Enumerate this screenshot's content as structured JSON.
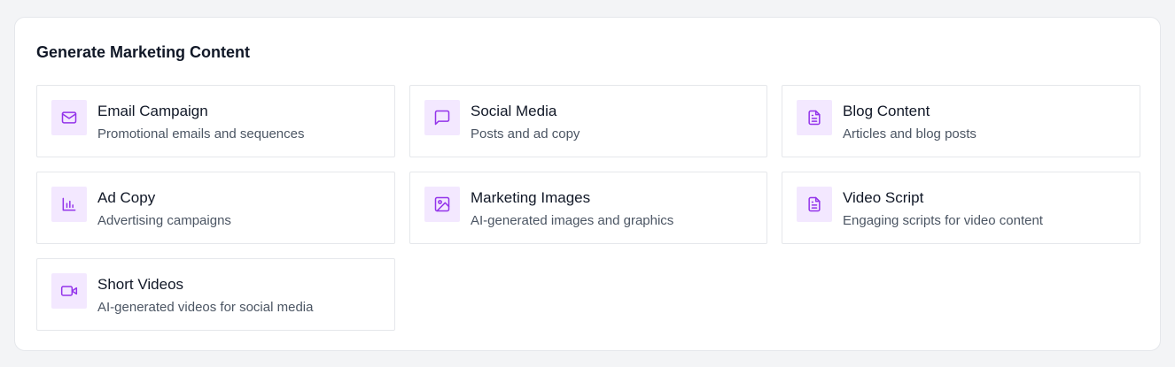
{
  "header": {
    "title": "Generate Marketing Content"
  },
  "colors": {
    "accent": "#9333ea",
    "icon_bg": "#f3e8ff"
  },
  "cards": [
    {
      "title": "Email Campaign",
      "description": "Promotional emails and sequences",
      "icon": "mail-icon"
    },
    {
      "title": "Social Media",
      "description": "Posts and ad copy",
      "icon": "message-square-icon"
    },
    {
      "title": "Blog Content",
      "description": "Articles and blog posts",
      "icon": "file-text-icon"
    },
    {
      "title": "Ad Copy",
      "description": "Advertising campaigns",
      "icon": "bar-chart-icon"
    },
    {
      "title": "Marketing Images",
      "description": "AI-generated images and graphics",
      "icon": "image-icon"
    },
    {
      "title": "Video Script",
      "description": "Engaging scripts for video content",
      "icon": "file-text-icon"
    },
    {
      "title": "Short Videos",
      "description": "AI-generated videos for social media",
      "icon": "video-icon"
    }
  ]
}
